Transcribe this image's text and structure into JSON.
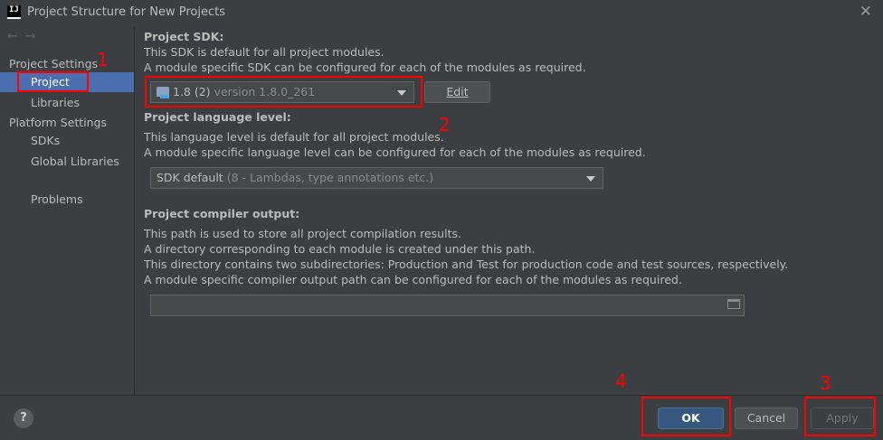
{
  "window": {
    "title": "Project Structure for New Projects",
    "close_glyph": "✕",
    "app_icon_text": "IJ"
  },
  "nav": {
    "back": "←",
    "forward": "→"
  },
  "sidebar": {
    "project_settings_label": "Project Settings",
    "project_items": [
      {
        "label": "Project",
        "selected": true
      },
      {
        "label": "Libraries"
      }
    ],
    "platform_settings_label": "Platform Settings",
    "platform_items": [
      {
        "label": "SDKs"
      },
      {
        "label": "Global Libraries"
      }
    ],
    "problems_label": "Problems"
  },
  "sdk": {
    "heading": "Project SDK:",
    "line1": "This SDK is default for all project modules.",
    "line2": "A module specific SDK can be configured for each of the modules as required.",
    "value_name": "1.8 (2)",
    "value_version": "version 1.8.0_261",
    "edit_label": "Edit"
  },
  "language": {
    "heading": "Project language level:",
    "line1": "This language level is default for all project modules.",
    "line2": "A module specific language level can be configured for each of the modules as required.",
    "value_main": "SDK default",
    "value_detail": "(8 - Lambdas, type annotations etc.)"
  },
  "compiler": {
    "heading": "Project compiler output:",
    "lines": [
      "This path is used to store all project compilation results.",
      "A directory corresponding to each module is created under this path.",
      "This directory contains two subdirectories: Production and Test for production code and test sources, respectively.",
      "A module specific compiler output path can be configured for each of the modules as required."
    ],
    "path_value": ""
  },
  "footer": {
    "help_label": "?",
    "ok_label": "OK",
    "cancel_label": "Cancel",
    "apply_label": "Apply"
  },
  "annotations": {
    "n1": "1",
    "n2": "2",
    "n3": "3",
    "n4": "4"
  },
  "colors": {
    "accent_selection": "#4b6eaf",
    "primary_button": "#365880",
    "annotation_red": "#ff0000",
    "background": "#3c3f41"
  }
}
